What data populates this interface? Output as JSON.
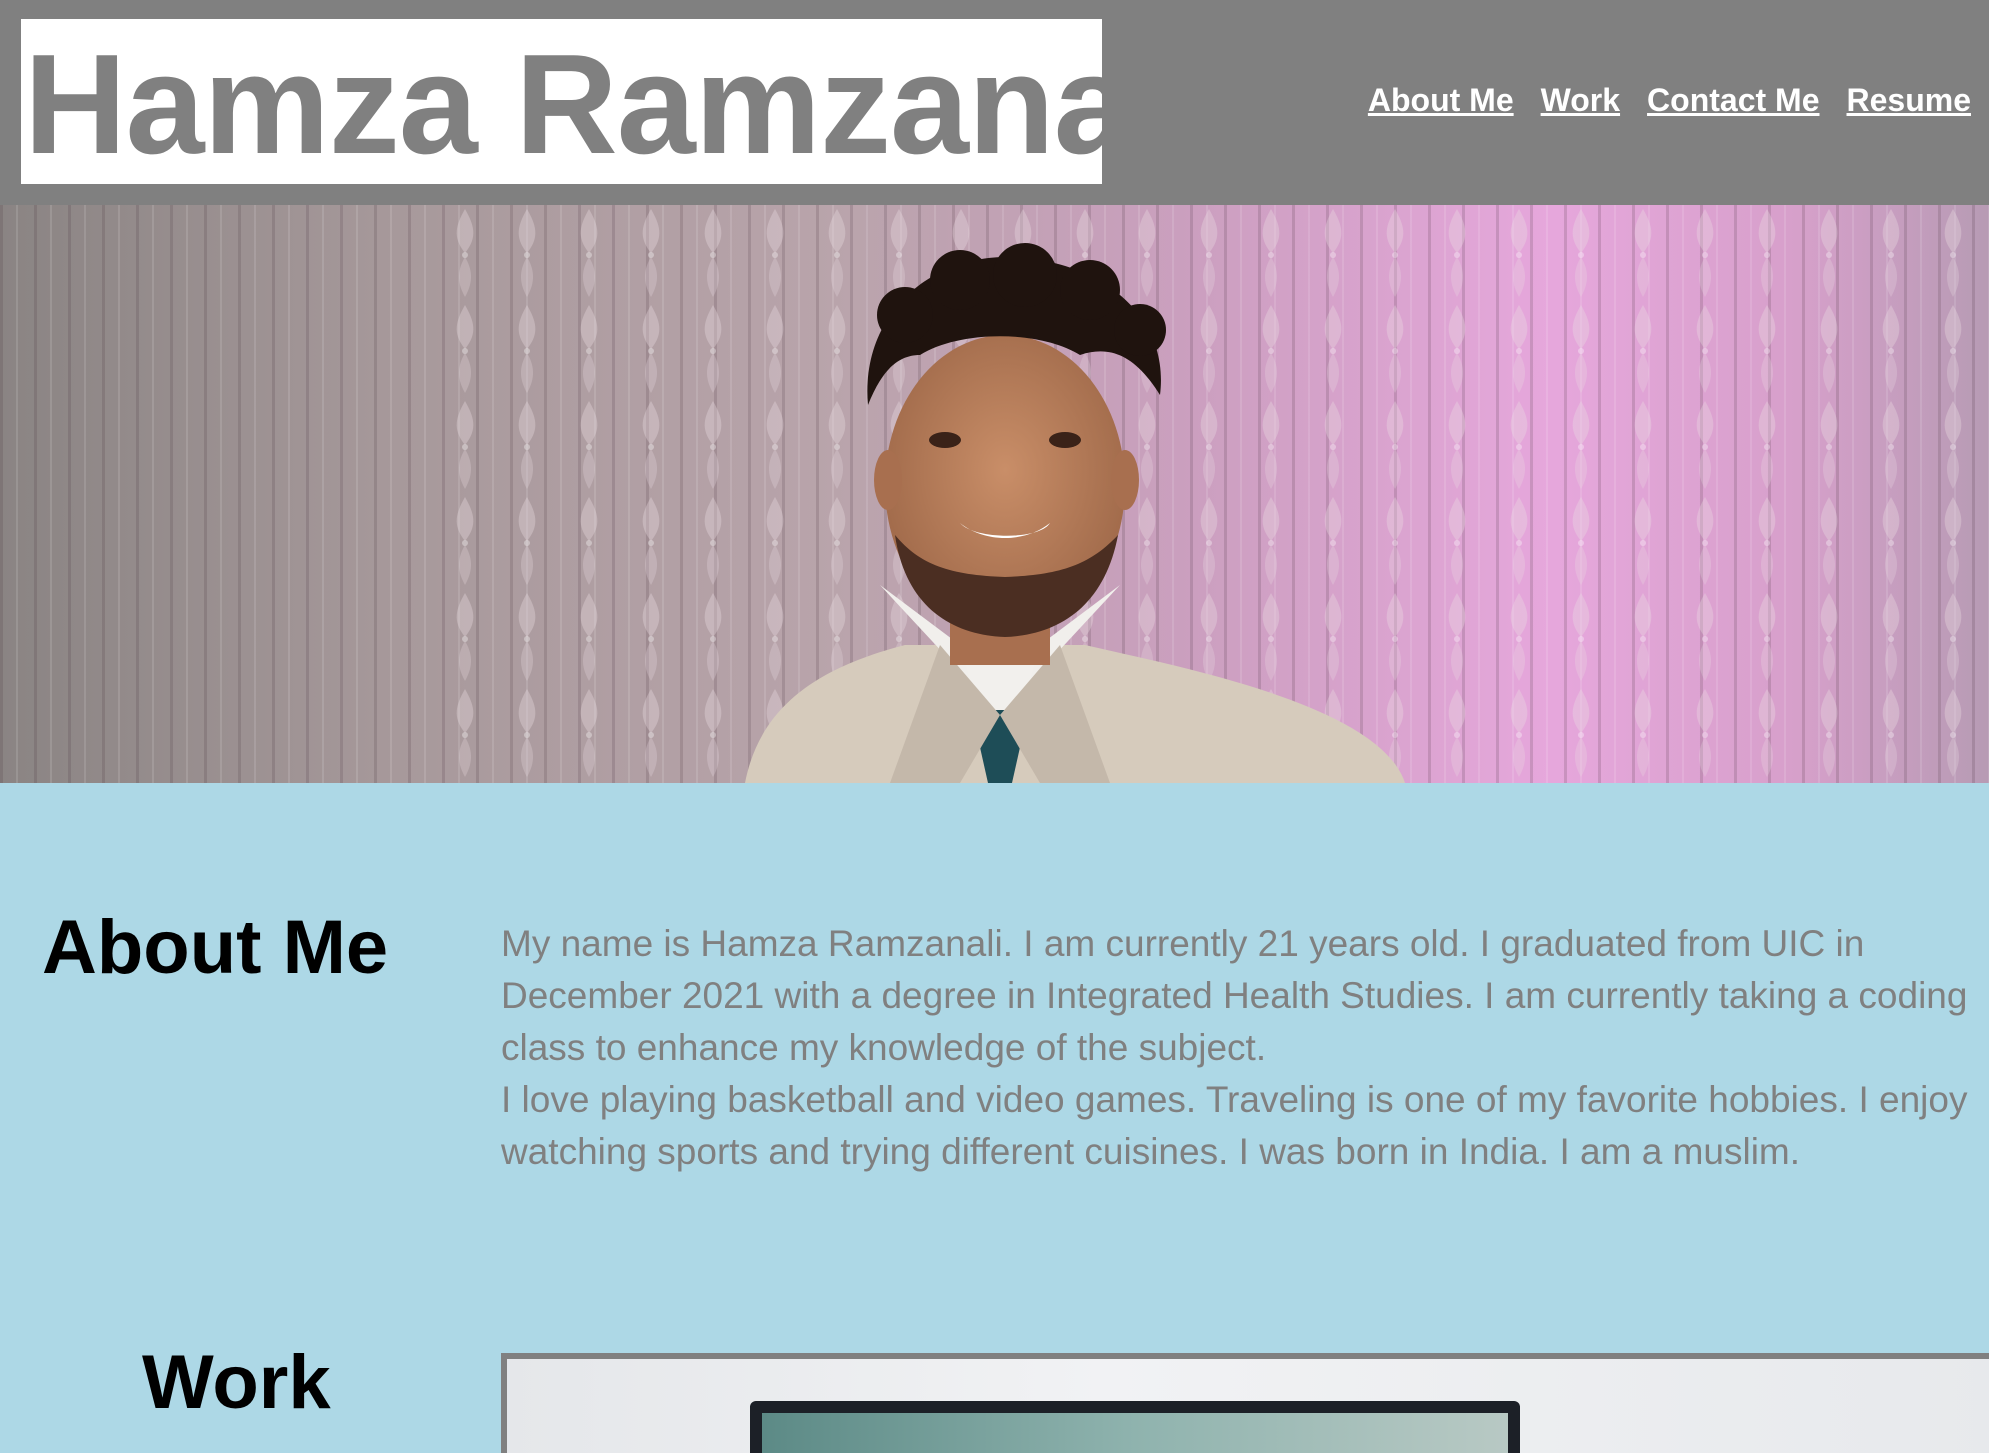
{
  "header": {
    "logo_text": "Hamza Ramzanali",
    "nav": [
      {
        "label": "About Me"
      },
      {
        "label": "Work"
      },
      {
        "label": "Contact Me"
      },
      {
        "label": "Resume"
      }
    ]
  },
  "about": {
    "title": "About Me",
    "paragraph1": "My name is Hamza Ramzanali. I am currently 21 years old. I graduated from UIC in December 2021 with a degree in Integrated Health Studies. I am currently taking a coding class to enhance my knowledge of the subject.",
    "paragraph2": "I love playing basketball and video games. Traveling is one of my favorite hobbies. I enjoy watching sports and trying different cuisines. I was born in India. I am a muslim."
  },
  "work": {
    "title": "Work"
  },
  "colors": {
    "header_bg": "#808080",
    "page_bg": "#add8e6",
    "logo_bg": "#ffffff",
    "logo_text": "#808080",
    "nav_text": "#ffffff",
    "body_text": "#808080",
    "heading_text": "#000000"
  }
}
